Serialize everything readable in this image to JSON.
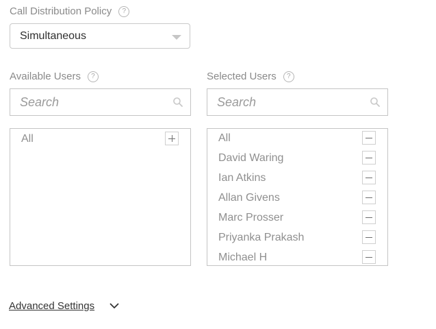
{
  "call_distribution": {
    "label": "Call Distribution Policy",
    "help": "?",
    "selected": "Simultaneous"
  },
  "available": {
    "label": "Available Users",
    "help": "?",
    "search_placeholder": "Search",
    "items": [
      {
        "label": "All",
        "action_icon": "plus-icon"
      }
    ]
  },
  "selected": {
    "label": "Selected Users",
    "help": "?",
    "search_placeholder": "Search",
    "items": [
      {
        "label": "All",
        "action_icon": "minus-icon"
      },
      {
        "label": "David Waring",
        "action_icon": "minus-icon"
      },
      {
        "label": "Ian Atkins",
        "action_icon": "minus-icon"
      },
      {
        "label": "Allan Givens",
        "action_icon": "minus-icon"
      },
      {
        "label": "Marc Prosser",
        "action_icon": "minus-icon"
      },
      {
        "label": "Priyanka Prakash",
        "action_icon": "minus-icon"
      },
      {
        "label": "Michael H",
        "action_icon": "minus-icon"
      }
    ]
  },
  "advanced": {
    "label": "Advanced Settings",
    "icon": "chevron-down-icon"
  },
  "colors": {
    "label_gray": "#8a8a8a",
    "border": "#c4c4c4",
    "item_text": "#8f8f8f"
  }
}
